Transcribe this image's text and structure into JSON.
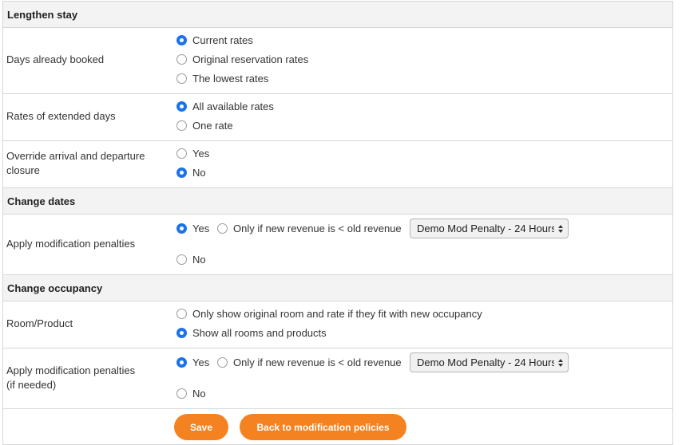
{
  "lengthen_stay": {
    "header": "Lengthen stay",
    "days_booked": {
      "label": "Days already booked",
      "options": [
        "Current rates",
        "Original reservation rates",
        "The lowest rates"
      ],
      "selected": 0
    },
    "extended_rates": {
      "label": "Rates of extended days",
      "options": [
        "All available rates",
        "One rate"
      ],
      "selected": 0
    },
    "override": {
      "label_line1": "Override arrival and departure",
      "label_line2": "closure",
      "options": [
        "Yes",
        "No"
      ],
      "selected": 1
    }
  },
  "change_dates": {
    "header": "Change dates",
    "penalties": {
      "label": "Apply modification penalties",
      "yes": "Yes",
      "only_if": "Only if new revenue is < old revenue",
      "select_value": "Demo Mod Penalty - 24 Hours",
      "no": "No",
      "selected": "yes"
    }
  },
  "change_occupancy": {
    "header": "Change occupancy",
    "room_product": {
      "label": "Room/Product",
      "options": [
        "Only show original room and rate if they fit with new occupancy",
        "Show all rooms and products"
      ],
      "selected": 1
    },
    "penalties": {
      "label_line1": "Apply modification penalties",
      "label_line2": "(if needed)",
      "yes": "Yes",
      "only_if": "Only if new revenue is < old revenue",
      "select_value": "Demo Mod Penalty - 24 Hours",
      "no": "No",
      "selected": "yes"
    }
  },
  "actions": {
    "save": "Save",
    "back": "Back to modification policies"
  },
  "colors": {
    "accent_button": "#f58220",
    "radio_selected": "#1a73e8",
    "header_bg": "#f3f3f3"
  }
}
